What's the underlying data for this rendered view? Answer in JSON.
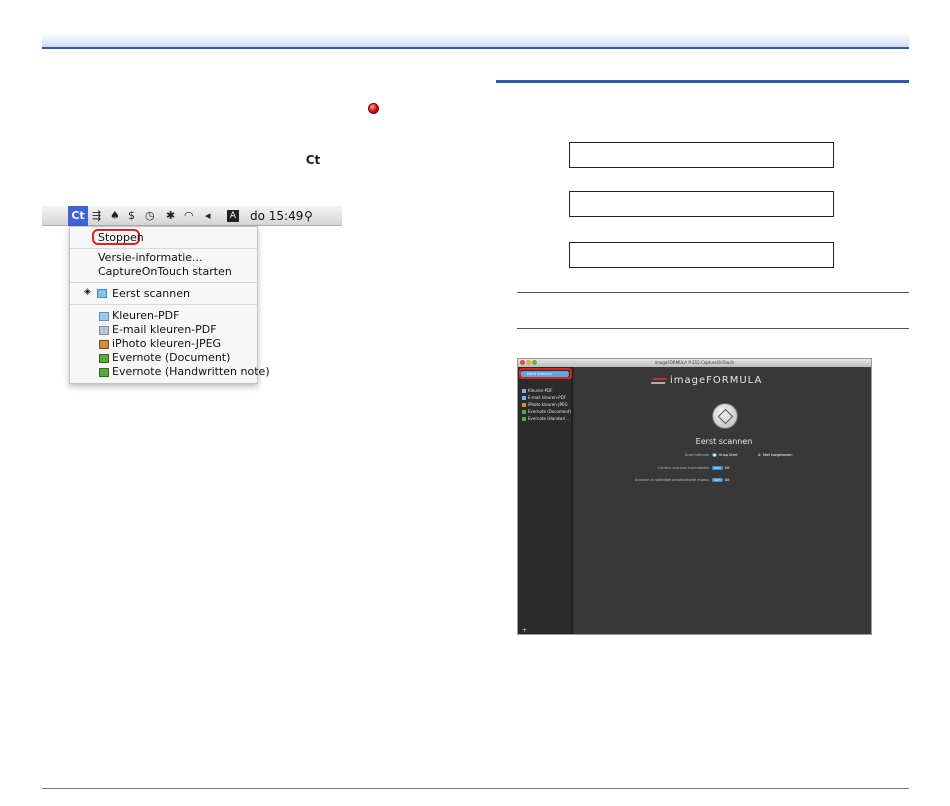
{
  "menubar": {
    "ct_label": "Ct",
    "clock": "do 15:49",
    "icons": [
      "airdrop-icon",
      "evernote-icon",
      "scrivener-icon",
      "time-machine-icon",
      "bluetooth-icon",
      "wifi-icon",
      "volume-icon",
      "keyboard-icon",
      "spotlight-icon"
    ]
  },
  "menu": {
    "stop": "Stoppen",
    "version": "Versie-informatie...",
    "start_app": "CaptureOnTouch starten",
    "first_scan": "Eerst scannen",
    "jobs": [
      {
        "label": "Kleuren-PDF",
        "icon": "folder-icon"
      },
      {
        "label": "E-mail kleuren-PDF",
        "icon": "mail-icon"
      },
      {
        "label": "iPhoto kleuren-JPEG",
        "icon": "iphoto-icon"
      },
      {
        "label": "Evernote (Document)",
        "icon": "evernote-icon"
      },
      {
        "label": "Evernote (Handwritten note)",
        "icon": "evernote-icon"
      }
    ]
  },
  "inline_icons": {
    "ct": "Ct"
  },
  "window": {
    "title": "imageFORMULA P-215 CaptureOnTouch",
    "sidebar": {
      "selected": "Eerst scannen",
      "items": [
        "Kleuren-PDF",
        "E-mail kleuren-PDF",
        "iPhoto kleuren-JPEG",
        "Evernote (Document)",
        "Evernote (Handwri..."
      ],
      "add": "+"
    },
    "logo": "imageFORMULA",
    "job_title": "Eerst scannen",
    "rows": [
      {
        "label": "Scanmethode",
        "value": "Knop Start",
        "extra": "Niet toegewezen"
      },
      {
        "label": "Continu scannen inschakelen",
        "on": "Aan",
        "off": "Uit"
      },
      {
        "label": "Scannen in volledige automatische modus",
        "on": "Aan",
        "off": "Uit"
      }
    ]
  },
  "colors": {
    "accent": "#2f5aa8",
    "highlight": "#e12020",
    "menubar_selected": "#3e64d6"
  }
}
